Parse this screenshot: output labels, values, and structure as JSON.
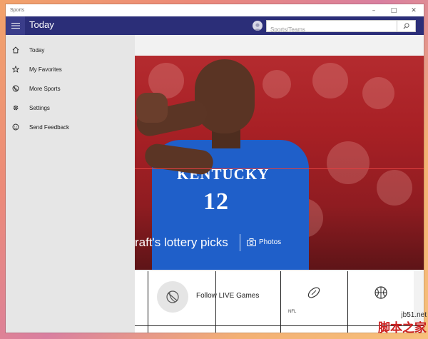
{
  "window": {
    "title": "Sports"
  },
  "header": {
    "page_title": "Today"
  },
  "search": {
    "placeholder": "Sports/Teams"
  },
  "nav": {
    "items": [
      {
        "label": "Today",
        "icon": "home-icon"
      },
      {
        "label": "My Favorites",
        "icon": "star-icon"
      },
      {
        "label": "More Sports",
        "icon": "sports-ball-icon"
      },
      {
        "label": "Settings",
        "icon": "gear-icon"
      },
      {
        "label": "Send Feedback",
        "icon": "smiley-icon"
      }
    ]
  },
  "hero": {
    "jersey_name": "KENTUCKY",
    "jersey_number": "12",
    "headline": "raft's lottery picks",
    "photos_label": "Photos"
  },
  "tiles": {
    "follow_label": "Follow LIVE Games",
    "nfl_label": "NFL"
  },
  "watermark": {
    "site": "jb51.net",
    "cn": "脚本之家"
  },
  "colors": {
    "header": "#2b2e78",
    "nav_bg": "#e6e6e6",
    "hero_red": "#b42b2f",
    "jersey_blue": "#1f5fc9"
  }
}
